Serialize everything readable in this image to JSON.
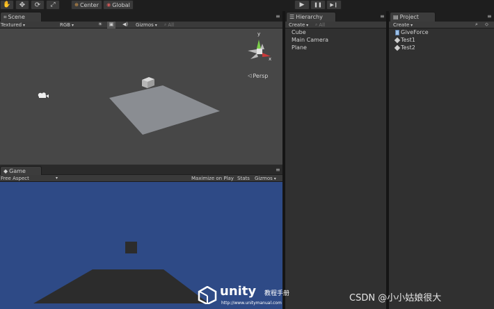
{
  "toolbar": {
    "pivot_label": "Center",
    "space_label": "Global",
    "play_icon": "▶",
    "pause_icon": "❚❚",
    "step_icon": "▶❙"
  },
  "scene": {
    "tab_label": "Scene",
    "draw_mode": "Textured",
    "render_mode": "RGB",
    "gizmos_label": "Gizmos",
    "search_placeholder": "All",
    "persp_label": "Persp",
    "axis_y": "y",
    "axis_x": "x"
  },
  "game": {
    "tab_label": "Game",
    "aspect": "Free Aspect",
    "maximize_label": "Maximize on Play",
    "stats_label": "Stats",
    "gizmos_label": "Gizmos"
  },
  "hierarchy": {
    "tab_label": "Hierarchy",
    "create_label": "Create",
    "search_placeholder": "All",
    "items": [
      "Cube",
      "Main Camera",
      "Plane"
    ]
  },
  "project": {
    "tab_label": "Project",
    "create_label": "Create",
    "items": [
      "GiveForce",
      "Test1",
      "Test2"
    ]
  },
  "watermark": {
    "brand": "unity",
    "cn": "教程手册",
    "url": "http://www.unitymanual.com",
    "csdn": "CSDN @小小姑娘很大"
  },
  "colors": {
    "scene_bg": "#474747",
    "game_bg": "#2e4a86",
    "plane": "#8a8d92"
  }
}
